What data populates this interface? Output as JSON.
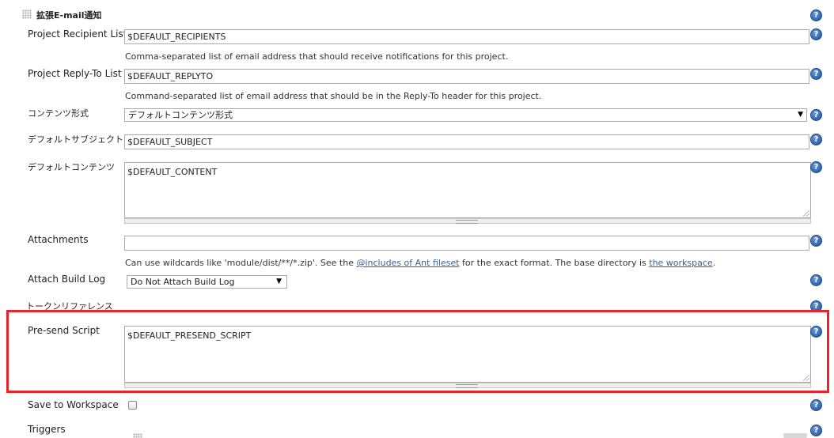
{
  "section": {
    "title": "拡張E-mail通知"
  },
  "fields": {
    "recipients": {
      "label": "Project Recipient List",
      "value": "$DEFAULT_RECIPIENTS",
      "description": "Comma-separated list of email address that should receive notifications for this project."
    },
    "reply_to": {
      "label": "Project Reply-To List",
      "value": "$DEFAULT_REPLYTO",
      "description": "Command-separated list of email address that should be in the Reply-To header for this project."
    },
    "content_type": {
      "label": "コンテンツ形式",
      "value": "デフォルトコンテンツ形式"
    },
    "subject": {
      "label": "デフォルトサブジェクト",
      "value": "$DEFAULT_SUBJECT"
    },
    "content": {
      "label": "デフォルトコンテンツ",
      "value": "$DEFAULT_CONTENT"
    },
    "attachments": {
      "label": "Attachments",
      "value": "",
      "desc_pre": "Can use wildcards like 'module/dist/**/*.zip'. See the ",
      "desc_link1": "@includes of Ant fileset",
      "desc_mid": " for the exact format. The base directory is ",
      "desc_link2": "the workspace",
      "desc_post": "."
    },
    "attach_build_log": {
      "label": "Attach Build Log",
      "value": "Do Not Attach Build Log"
    },
    "token_reference": {
      "label": "トークンリファレンス"
    },
    "presend_script": {
      "label": "Pre-send Script",
      "value": "$DEFAULT_PRESEND_SCRIPT"
    },
    "save_to_workspace": {
      "label": "Save to Workspace",
      "checked": false
    },
    "triggers": {
      "label": "Triggers"
    }
  },
  "icons": {
    "help": "help-icon",
    "help_glyph": "?",
    "select_arrow": "▼"
  },
  "colors": {
    "highlight": "#e8232b",
    "help": "#2f64ad",
    "link": "#3a5f8f"
  }
}
